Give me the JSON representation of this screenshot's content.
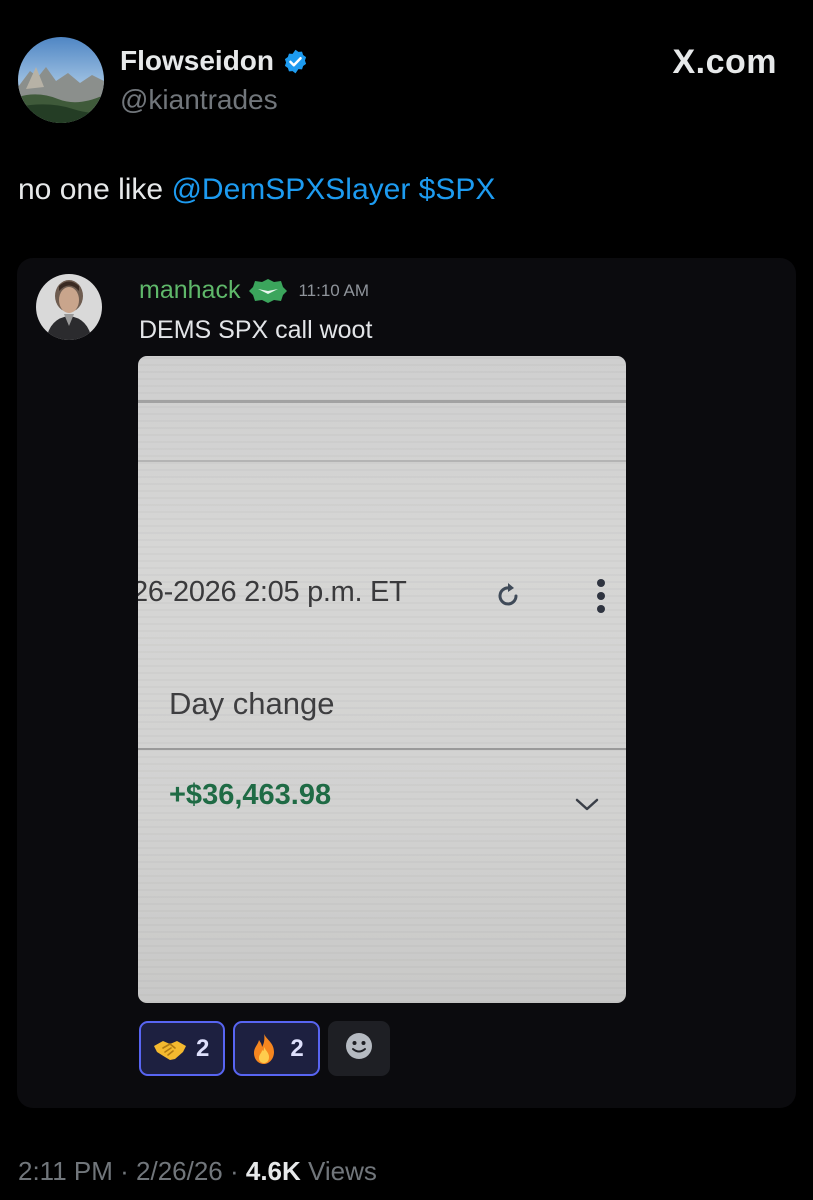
{
  "header": {
    "display_name": "Flowseidon",
    "handle": "@kiantrades",
    "brand": "X.com"
  },
  "tweet": {
    "text_prefix": "no one like ",
    "mention": "@DemSPXSlayer",
    "cashtag": "$SPX"
  },
  "discord_message": {
    "username": "manhack",
    "time": "11:10 AM",
    "message": "DEMS SPX call woot",
    "screenshot": {
      "date_time": "26-2026 2:05 p.m. ET",
      "day_change_label": "Day change",
      "day_change_value": "+$36,463.98"
    },
    "reactions": [
      {
        "emoji": "handshake-icon",
        "count": "2"
      },
      {
        "emoji": "fire-icon",
        "count": "2"
      }
    ]
  },
  "footer": {
    "time": "2:11 PM",
    "date": "2/26/26",
    "views_count": "4.6K",
    "views_label": "Views"
  },
  "colors": {
    "background": "#000000",
    "link_blue": "#1d9bf0",
    "discord_username_green": "#5fb86a",
    "reaction_border": "#5865f2",
    "gain_green": "#1f6b45"
  }
}
